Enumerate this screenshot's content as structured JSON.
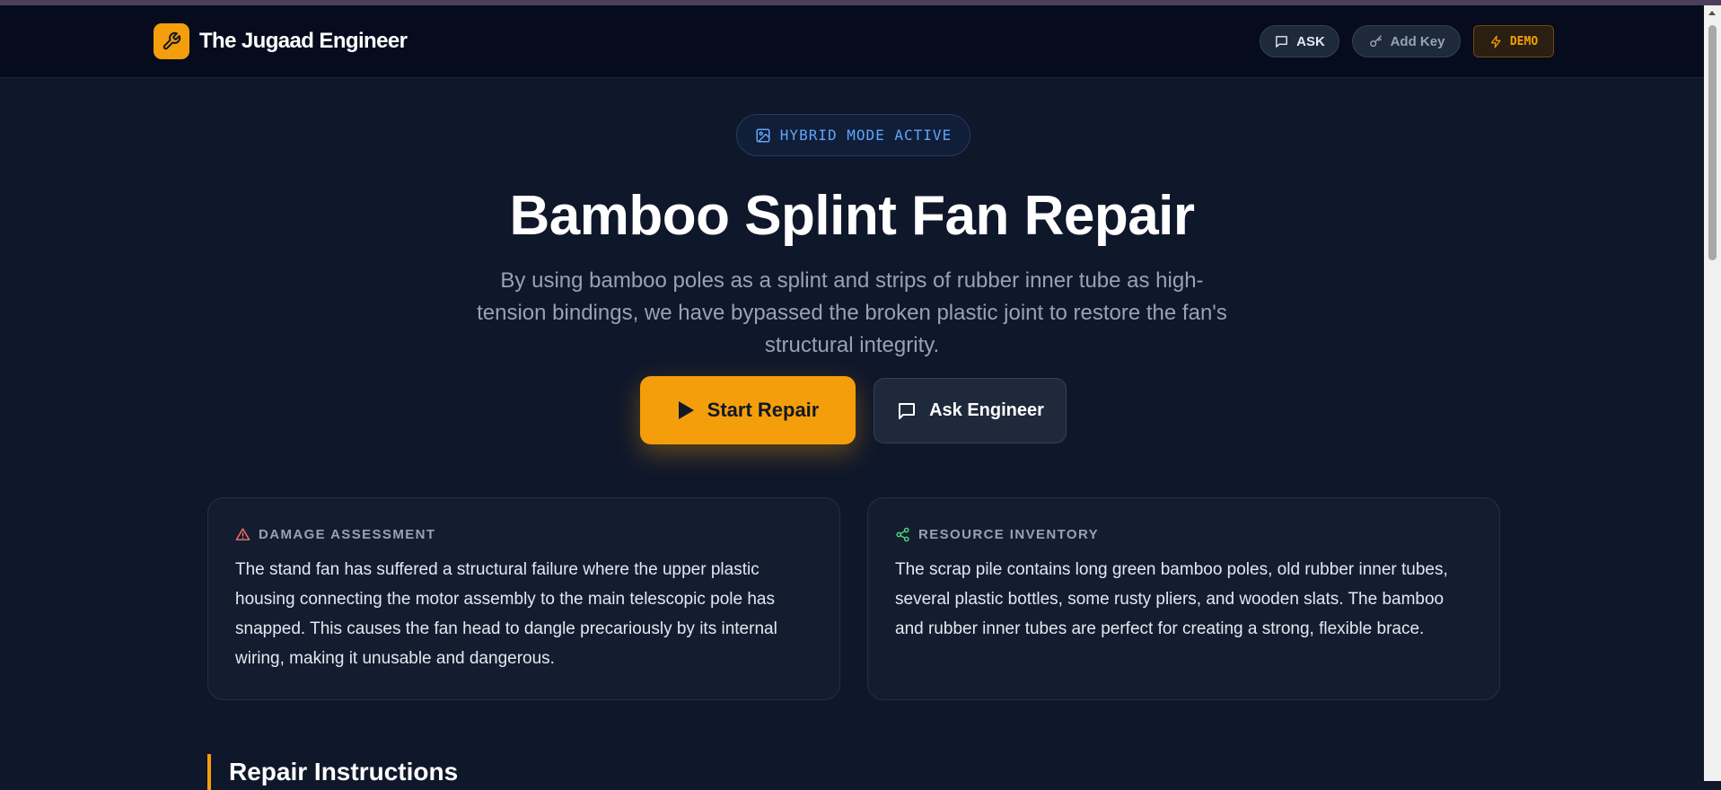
{
  "app": {
    "brand_name": "The Jugaad Engineer",
    "brand_icon": "wrench-icon",
    "accent_color": "#f59e0b"
  },
  "nav": {
    "ask_label": "ASK",
    "add_key_label": "Add Key",
    "demo_label": "DEMO"
  },
  "hero": {
    "badge_label": "HYBRID MODE ACTIVE",
    "title": "Bamboo Splint Fan Repair",
    "subtitle": "By using bamboo poles as a splint and strips of rubber inner tube as high-tension bindings, we have bypassed the broken plastic joint to restore the fan's structural integrity.",
    "start_label": "Start Repair",
    "ask_engineer_label": "Ask Engineer"
  },
  "cards": [
    {
      "title": "DAMAGE ASSESSMENT",
      "icon": "warning-triangle-icon",
      "icon_color": "#f87171",
      "body": "The stand fan has suffered a structural failure where the upper plastic housing connecting the motor assembly to the main telescopic pole has snapped. This causes the fan head to dangle precariously by its internal wiring, making it unusable and dangerous."
    },
    {
      "title": "RESOURCE INVENTORY",
      "icon": "share-nodes-icon",
      "icon_color": "#4ade80",
      "body": "The scrap pile contains long green bamboo poles, old rubber inner tubes, several plastic bottles, some rusty pliers, and wooden slats. The bamboo and rubber inner tubes are perfect for creating a strong, flexible brace."
    }
  ],
  "section": {
    "instructions_title": "Repair Instructions"
  }
}
